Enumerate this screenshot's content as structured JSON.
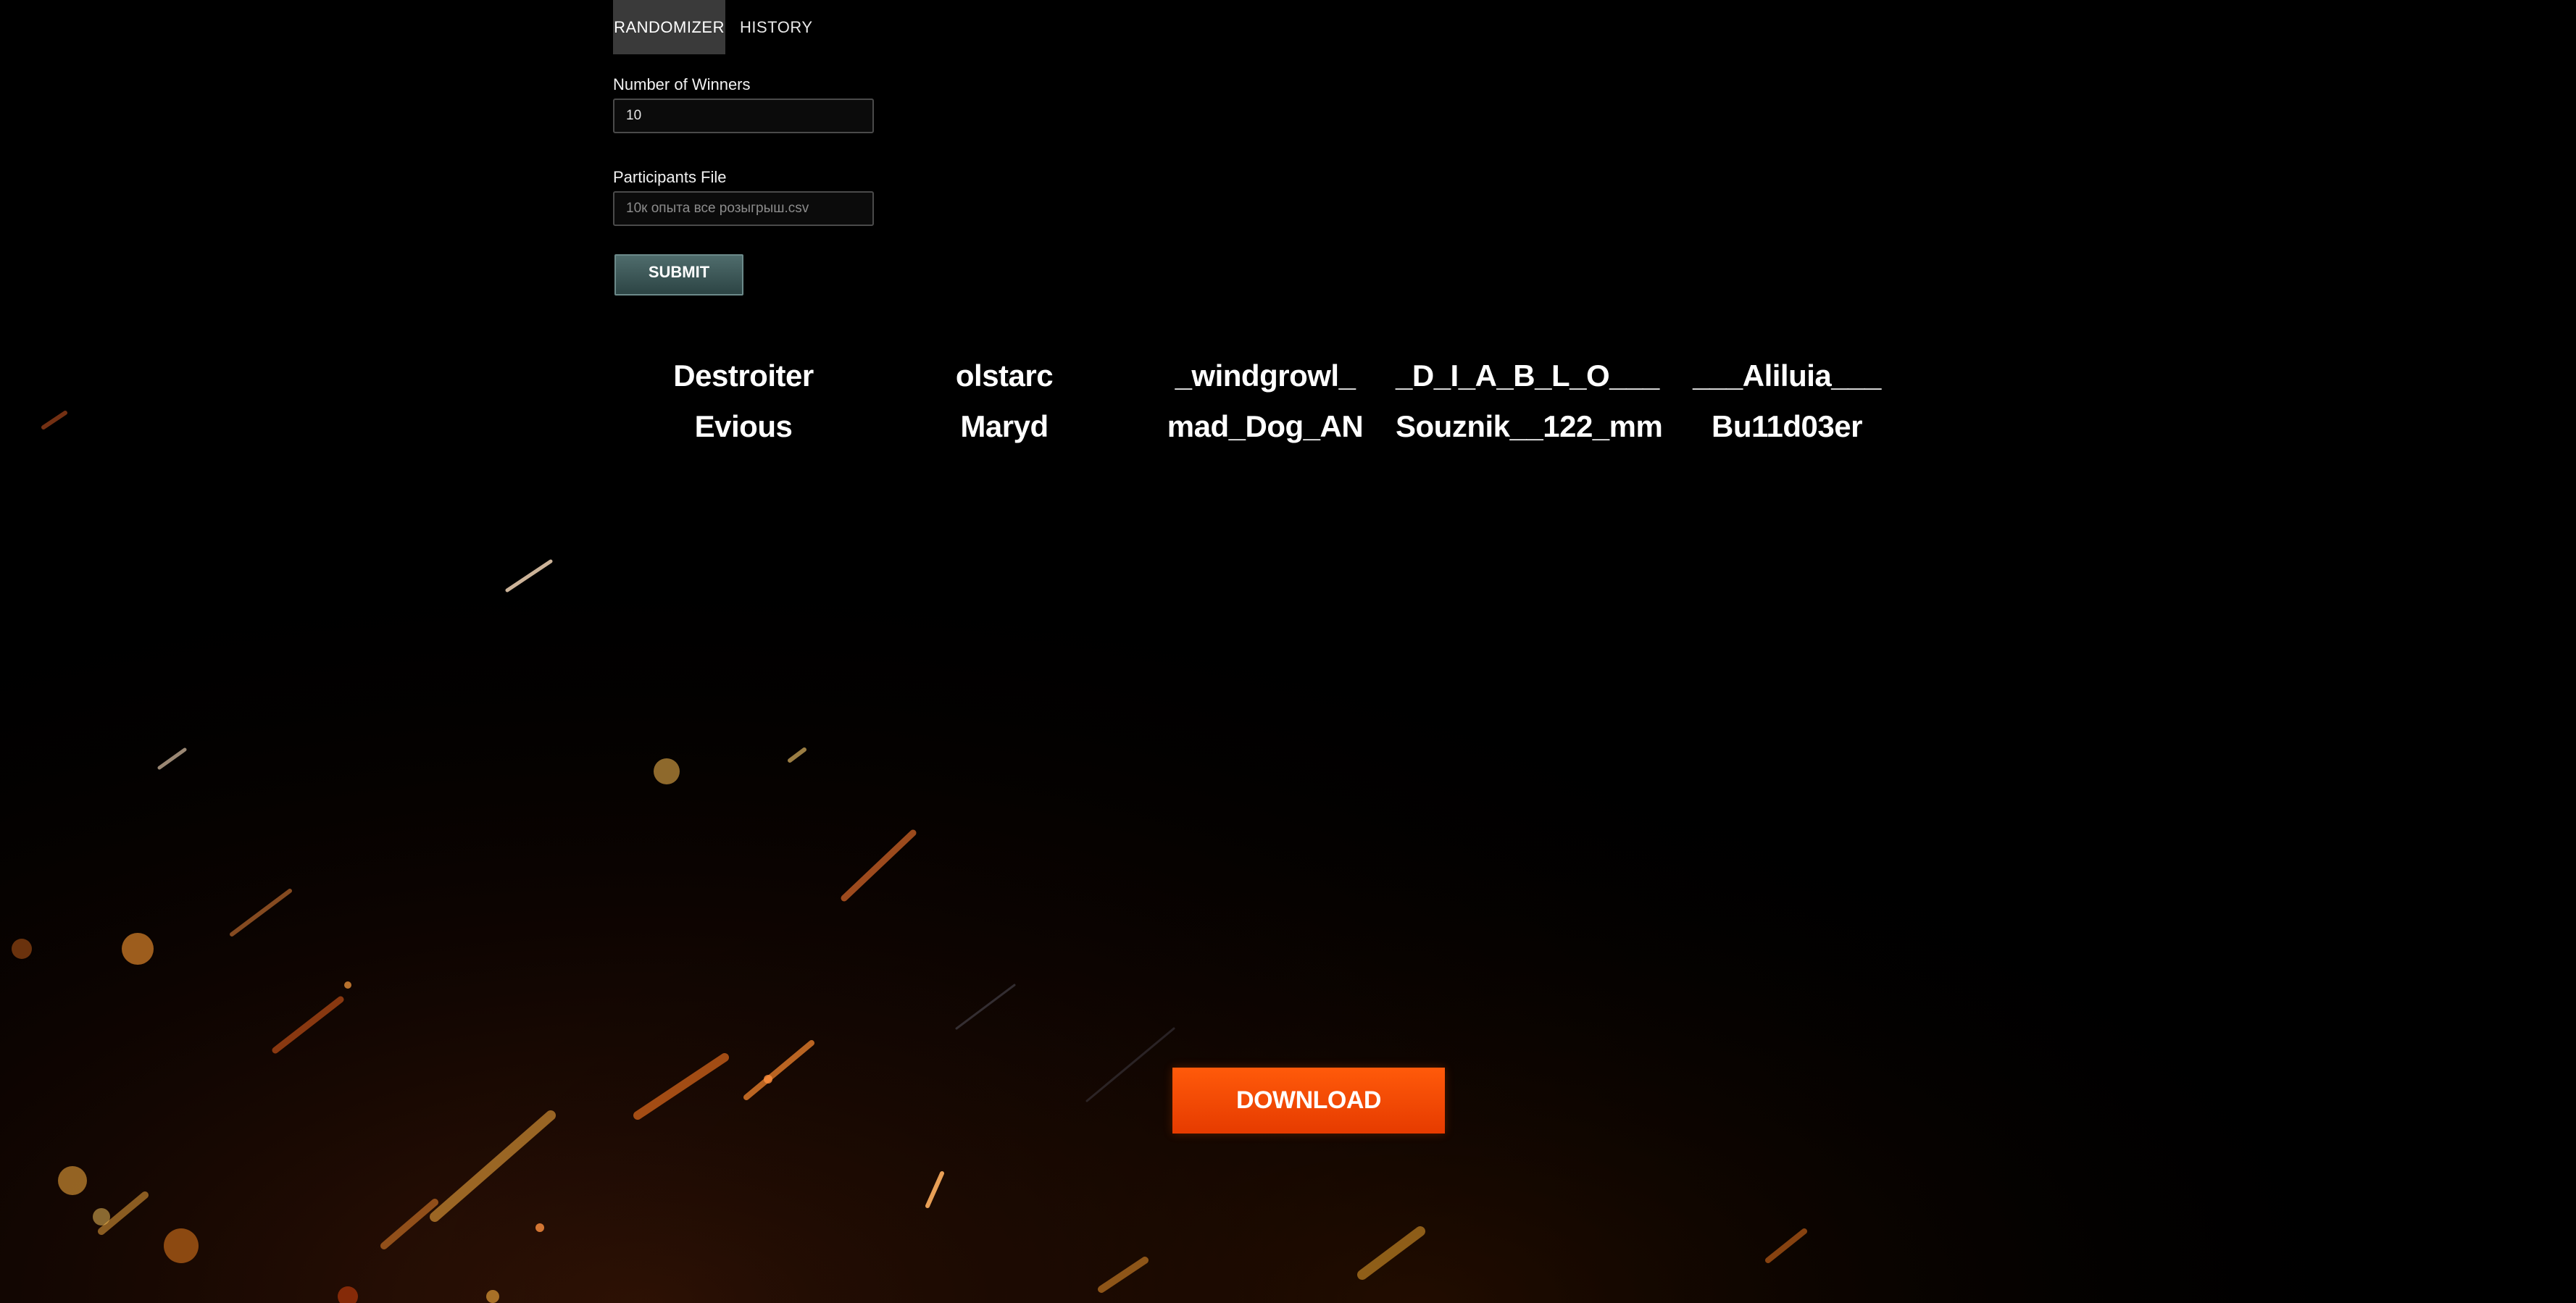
{
  "tabs": [
    {
      "label": "RANDOMIZER",
      "active": true
    },
    {
      "label": "HISTORY",
      "active": false
    }
  ],
  "form": {
    "winners_label": "Number of Winners",
    "winners_value": "10",
    "file_label": "Participants File",
    "file_value": "10к опыта все розыгрыш.csv",
    "submit_label": "SUBMIT"
  },
  "winners": [
    "Destroiter",
    "olstarc",
    "_windgrowl_",
    "_D_I_A_B_L_O___",
    "___Aliluia___",
    "Evious",
    "Maryd",
    "mad_Dog_AN",
    "Souznik__122_mm",
    "Bu11d03er"
  ],
  "download": {
    "label": "DOWNLOAD"
  },
  "colors": {
    "background": "#000000",
    "tab_active_bg": "#3a3a3a",
    "submit_bg": "#3d5757",
    "download_bg": "#f04a00"
  }
}
